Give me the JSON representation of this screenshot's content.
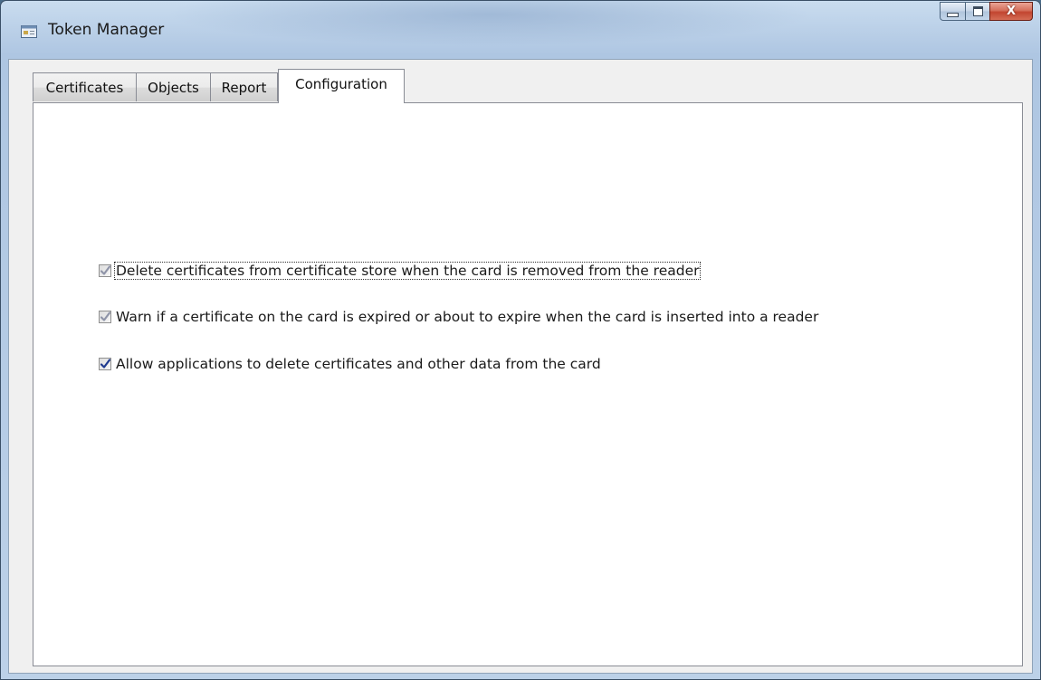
{
  "window": {
    "title": "Token Manager",
    "app_icon": "token-manager-icon",
    "caption": {
      "minimize_icon": "minimize-icon",
      "maximize_icon": "maximize-icon",
      "close_icon": "close-icon",
      "close_glyph": "X"
    }
  },
  "tabs": [
    {
      "label": "Certificates",
      "active": false
    },
    {
      "label": "Objects",
      "active": false
    },
    {
      "label": "Report",
      "active": false
    },
    {
      "label": "Configuration",
      "active": true
    }
  ],
  "configuration": {
    "options": [
      {
        "label": "Delete certificates from certificate store when the card is removed from the reader",
        "checked": true,
        "enabled": false,
        "focused": true
      },
      {
        "label": "Warn if a certificate on the card is expired or about to expire when the card is inserted into a reader",
        "checked": true,
        "enabled": false,
        "focused": false
      },
      {
        "label": "Allow applications to delete certificates and other data from the card",
        "checked": true,
        "enabled": true,
        "focused": false
      }
    ]
  },
  "colors": {
    "check_enabled": "#1f3a8f",
    "check_disabled": "#8f94a8",
    "close_button": "#c94a34"
  }
}
